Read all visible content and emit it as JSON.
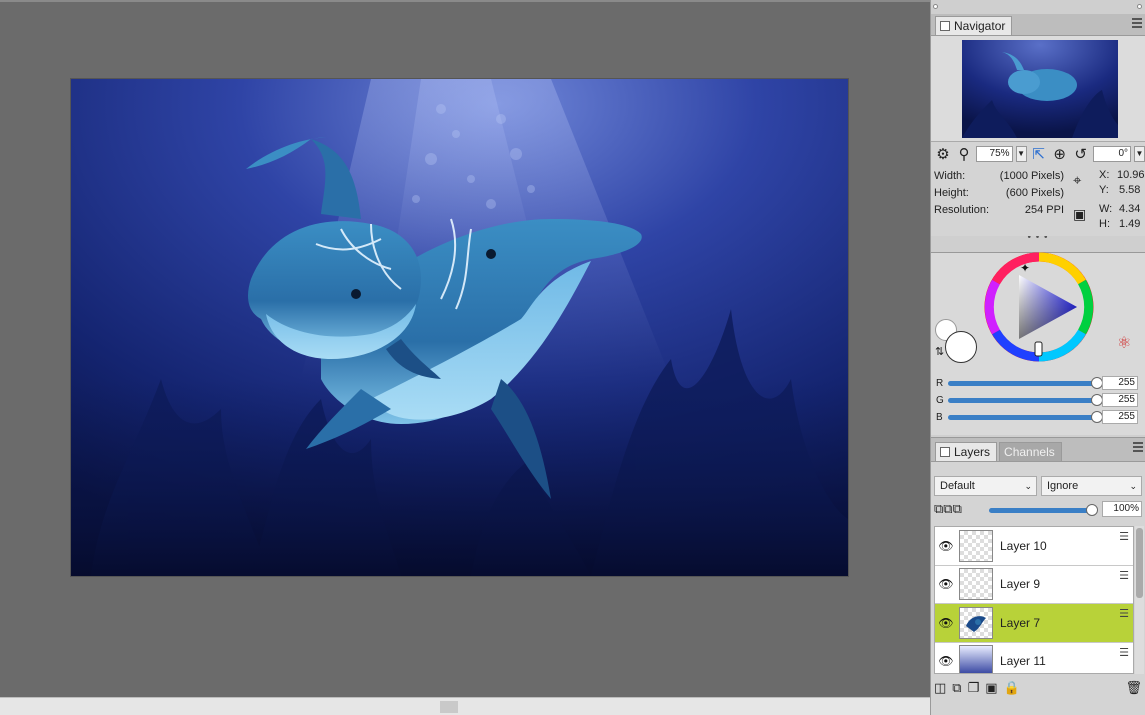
{
  "navigator": {
    "tab_label": "Navigator",
    "zoom_value": "75%",
    "rotation_value": "0°",
    "width_label": "Width:",
    "width_value": "(1000 Pixels)",
    "height_label": "Height:",
    "height_value": "(600 Pixels)",
    "resolution_label": "Resolution:",
    "resolution_value": "254 PPI",
    "x_label": "X:",
    "x_value": "10.96",
    "y_label": "Y:",
    "y_value": "5.58",
    "w_label": "W:",
    "w_value": "4.34",
    "h_label": "H:",
    "h_value": "1.49"
  },
  "color": {
    "r_label": "R",
    "r_value": "255",
    "r_level": 1.0,
    "g_label": "G",
    "g_value": "255",
    "g_level": 1.0,
    "b_label": "B",
    "b_value": "255",
    "b_level": 1.0,
    "primary_color": "#ffffff",
    "secondary_color": "#ffffff"
  },
  "layers": {
    "tab_label": "Layers",
    "channels_tab_label": "Channels",
    "composite_method": "Default",
    "preserve_mode": "Ignore",
    "opacity_value": "100%",
    "opacity_level": 1.0,
    "items": [
      {
        "name": "Layer 10",
        "selected": false
      },
      {
        "name": "Layer 9",
        "selected": false
      },
      {
        "name": "Layer 7",
        "selected": true
      },
      {
        "name": "Layer 11",
        "selected": false
      }
    ]
  },
  "colors": {
    "accent": "#3a7fc6",
    "selected_layer": "#b8d239"
  },
  "icons": {
    "eye": "eye-icon",
    "settings": "gear-icon",
    "zoom": "magnifier-icon",
    "rotate": "rotate-icon"
  }
}
